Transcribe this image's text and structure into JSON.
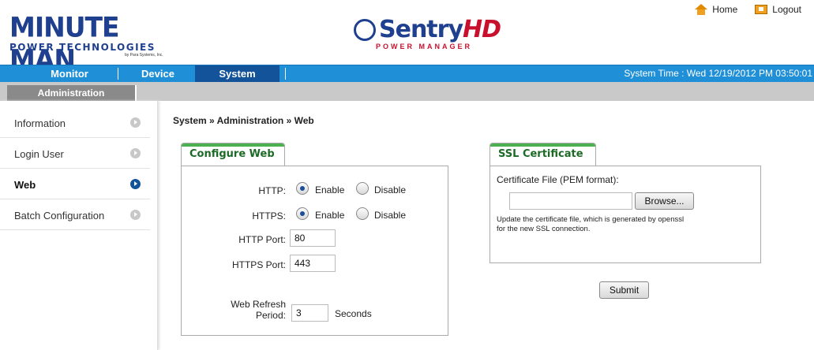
{
  "header": {
    "brand_main": "MINUTE MAN",
    "brand_sub": "POWER TECHNOLOGIES",
    "brand_para": "by Para Systems, Inc.",
    "product_name_a": "Sentry",
    "product_name_b": "HD",
    "product_sub": "POWER MANAGER",
    "home_label": "Home",
    "logout_label": "Logout"
  },
  "nav": {
    "items": [
      {
        "label": "Monitor"
      },
      {
        "label": "Device"
      },
      {
        "label": "System"
      }
    ],
    "active": "System",
    "system_time": "System Time : Wed 12/19/2012 PM 03:50:01"
  },
  "subnav": {
    "tab": "Administration"
  },
  "sidebar": {
    "items": [
      {
        "label": "Information"
      },
      {
        "label": "Login User"
      },
      {
        "label": "Web"
      },
      {
        "label": "Batch Configuration"
      }
    ],
    "active": "Web"
  },
  "breadcrumb": "System » Administration » Web",
  "configure_web": {
    "title": "Configure Web",
    "http_label": "HTTP:",
    "https_label": "HTTPS:",
    "enable_label": "Enable",
    "disable_label": "Disable",
    "http_value": "Enable",
    "https_value": "Enable",
    "http_port_label": "HTTP Port:",
    "http_port": "80",
    "https_port_label": "HTTPS Port:",
    "https_port": "443",
    "refresh_label_1": "Web Refresh",
    "refresh_label_2": "Period:",
    "refresh_value": "3",
    "refresh_unit": "Seconds"
  },
  "ssl": {
    "title": "SSL Certificate",
    "file_label": "Certificate File (PEM format):",
    "file_value": "",
    "browse_label": "Browse...",
    "help_line_1": "Update the certificate file, which is generated by openssl",
    "help_line_2": "for the new SSL connection."
  },
  "submit_label": "Submit",
  "colors": {
    "nav_bg": "#1f8fd8",
    "nav_active": "#12539a",
    "brand_blue": "#1f3f8f",
    "brand_red": "#c8102e",
    "tab_green": "#4caf50"
  }
}
